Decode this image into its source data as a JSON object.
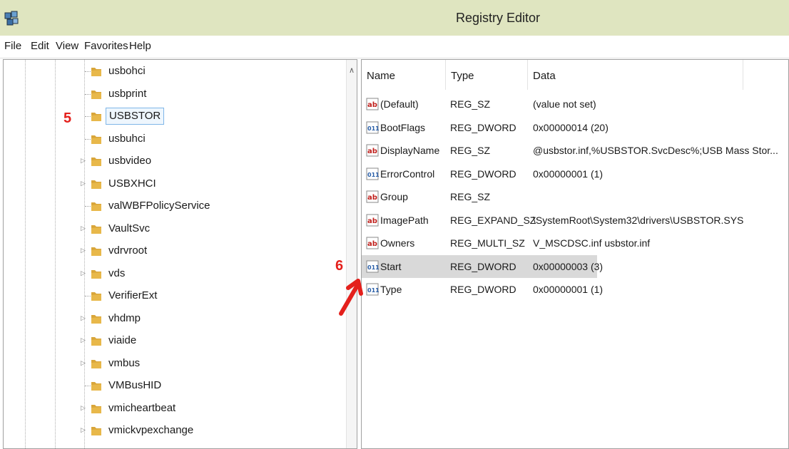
{
  "window": {
    "title": "Registry Editor"
  },
  "menu": {
    "items": [
      "File",
      "Edit",
      "View",
      "Favorites",
      "Help"
    ]
  },
  "tree": {
    "items": [
      {
        "label": "usbohci",
        "expandable": false,
        "selected": false
      },
      {
        "label": "usbprint",
        "expandable": false,
        "selected": false
      },
      {
        "label": "USBSTOR",
        "expandable": false,
        "selected": true
      },
      {
        "label": "usbuhci",
        "expandable": false,
        "selected": false
      },
      {
        "label": "usbvideo",
        "expandable": true,
        "selected": false
      },
      {
        "label": "USBXHCI",
        "expandable": true,
        "selected": false
      },
      {
        "label": "valWBFPolicyService",
        "expandable": false,
        "selected": false
      },
      {
        "label": "VaultSvc",
        "expandable": true,
        "selected": false
      },
      {
        "label": "vdrvroot",
        "expandable": true,
        "selected": false
      },
      {
        "label": "vds",
        "expandable": true,
        "selected": false
      },
      {
        "label": "VerifierExt",
        "expandable": false,
        "selected": false
      },
      {
        "label": "vhdmp",
        "expandable": true,
        "selected": false
      },
      {
        "label": "viaide",
        "expandable": true,
        "selected": false
      },
      {
        "label": "vmbus",
        "expandable": true,
        "selected": false
      },
      {
        "label": "VMBusHID",
        "expandable": false,
        "selected": false
      },
      {
        "label": "vmicheartbeat",
        "expandable": true,
        "selected": false
      },
      {
        "label": "vmickvpexchange",
        "expandable": true,
        "selected": false
      }
    ]
  },
  "list": {
    "columns": [
      "Name",
      "Type",
      "Data"
    ],
    "rows": [
      {
        "icon": "string-value-icon",
        "name": "(Default)",
        "type": "REG_SZ",
        "data": "(value not set)",
        "highlight": false
      },
      {
        "icon": "binary-value-icon",
        "name": "BootFlags",
        "type": "REG_DWORD",
        "data": "0x00000014 (20)",
        "highlight": false
      },
      {
        "icon": "string-value-icon",
        "name": "DisplayName",
        "type": "REG_SZ",
        "data": "@usbstor.inf,%USBSTOR.SvcDesc%;USB Mass Stor...",
        "highlight": false
      },
      {
        "icon": "binary-value-icon",
        "name": "ErrorControl",
        "type": "REG_DWORD",
        "data": "0x00000001 (1)",
        "highlight": false
      },
      {
        "icon": "string-value-icon",
        "name": "Group",
        "type": "REG_SZ",
        "data": "",
        "highlight": false
      },
      {
        "icon": "string-value-icon",
        "name": "ImagePath",
        "type": "REG_EXPAND_SZ",
        "data": "\\SystemRoot\\System32\\drivers\\USBSTOR.SYS",
        "highlight": false
      },
      {
        "icon": "string-value-icon",
        "name": "Owners",
        "type": "REG_MULTI_SZ",
        "data": "V_MSCDSC.inf usbstor.inf",
        "highlight": false
      },
      {
        "icon": "binary-value-icon",
        "name": "Start",
        "type": "REG_DWORD",
        "data": "0x00000003 (3)",
        "highlight": true
      },
      {
        "icon": "binary-value-icon",
        "name": "Type",
        "type": "REG_DWORD",
        "data": "0x00000001 (1)",
        "highlight": false
      }
    ]
  },
  "annotations": {
    "step5": "5",
    "step6": "6"
  },
  "colors": {
    "titlebar": "#dfe5c0",
    "annotation": "#e4201c",
    "highlight_row": "#d9d9d9",
    "folder": "#e8b84a"
  }
}
